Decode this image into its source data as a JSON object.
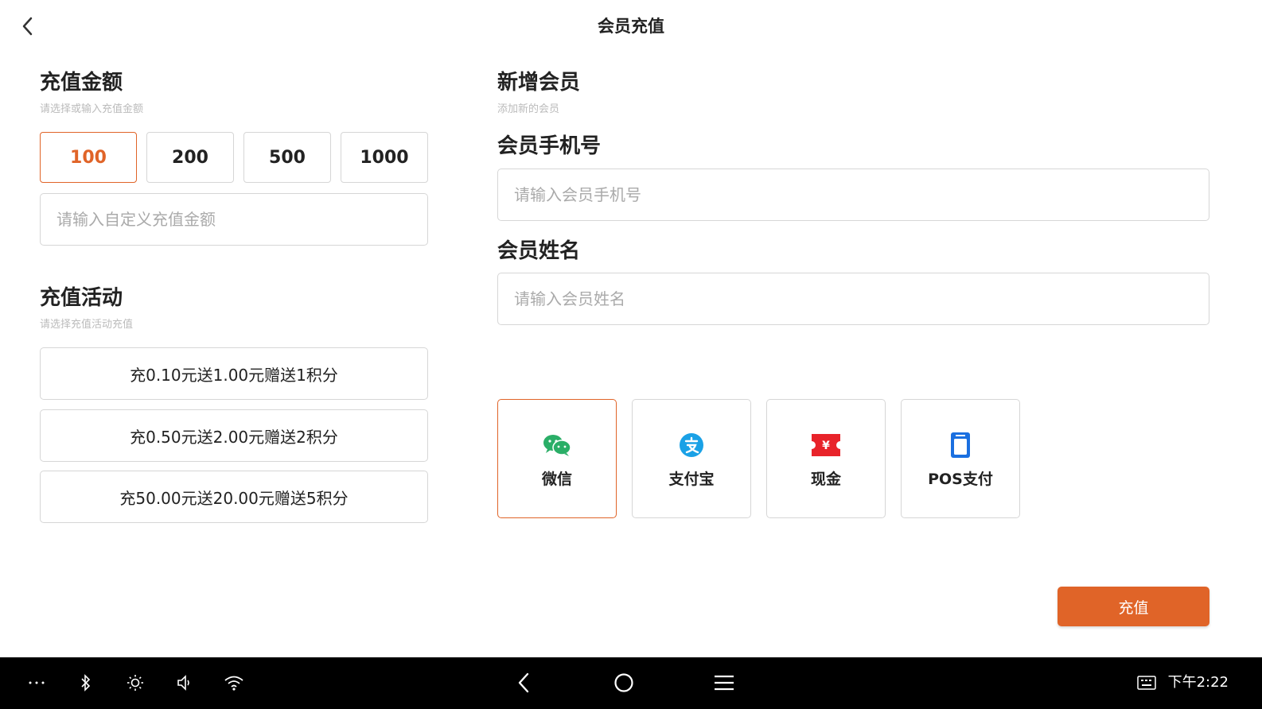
{
  "header": {
    "title": "会员充值",
    "back_icon": "chevron-left-icon"
  },
  "recharge_amount": {
    "title": "充值金额",
    "subtitle": "请选择或输入充值金额",
    "options": [
      "100",
      "200",
      "500",
      "1000"
    ],
    "selected": "100",
    "custom_placeholder": "请输入自定义充值金额"
  },
  "recharge_activity": {
    "title": "充值活动",
    "subtitle": "请选择充值活动充值",
    "items": [
      "充0.10元送1.00元赠送1积分",
      "充0.50元送2.00元赠送2积分",
      "充50.00元送20.00元赠送5积分"
    ]
  },
  "new_member": {
    "title": "新增会员",
    "subtitle": "添加新的会员",
    "phone_label": "会员手机号",
    "phone_placeholder": "请输入会员手机号",
    "name_label": "会员姓名",
    "name_placeholder": "请输入会员姓名"
  },
  "payment": {
    "methods": [
      {
        "label": "微信",
        "icon": "wechat-icon",
        "color": "#2aae67"
      },
      {
        "label": "支付宝",
        "icon": "alipay-icon",
        "color": "#1aa1e6"
      },
      {
        "label": "现金",
        "icon": "cash-icon",
        "color": "#e8232a"
      },
      {
        "label": "POS支付",
        "icon": "pos-icon",
        "color": "#1a6fe0"
      }
    ],
    "selected": "微信"
  },
  "submit_label": "充值",
  "colors": {
    "accent": "#e06428",
    "border": "#d6d6d6",
    "navbar": "#000000"
  },
  "system_bar": {
    "time": "下午2:22",
    "icons": [
      "more-icon",
      "bluetooth-icon",
      "brightness-icon",
      "volume-icon",
      "wifi-icon",
      "nav-back-icon",
      "nav-home-icon",
      "nav-menu-icon",
      "keyboard-icon"
    ]
  }
}
